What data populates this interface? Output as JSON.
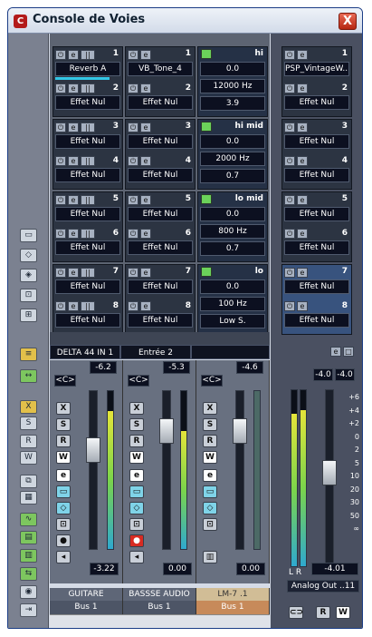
{
  "window": {
    "title": "Console de Voies",
    "close_label": "X"
  },
  "inserts": [
    [
      "Reverb A",
      "Effet Nul",
      "Effet Nul",
      "Effet Nul",
      "Effet Nul",
      "Effet Nul",
      "Effet Nul",
      "Effet Nul"
    ],
    [
      "VB_Tone_4",
      "Effet Nul",
      "Effet Nul",
      "Effet Nul",
      "Effet Nul",
      "Effet Nul",
      "Effet Nul",
      "Effet Nul"
    ]
  ],
  "slot_numbers": [
    "1",
    "2",
    "3",
    "4",
    "5",
    "6",
    "7",
    "8"
  ],
  "eq": [
    {
      "name": "hi",
      "gain": "0.0",
      "freq": "12000 Hz",
      "q": "3.9"
    },
    {
      "name": "hi mid",
      "gain": "0.0",
      "freq": "2000 Hz",
      "q": "0.7"
    },
    {
      "name": "lo mid",
      "gain": "0.0",
      "freq": "800 Hz",
      "q": "0.7"
    },
    {
      "name": "lo",
      "gain": "0.0",
      "freq": "100 Hz",
      "q": "Low S."
    }
  ],
  "master_inserts": [
    "PSP_VintageW...er",
    "Effet Nul",
    "Effet Nul",
    "Effet Nul",
    "Effet Nul",
    "Effet Nul",
    "Effet Nul",
    "Effet Nul"
  ],
  "routing": {
    "input": "DELTA 44 IN 1",
    "output": "Entrée 2"
  },
  "channels": [
    {
      "name": "GUITARE",
      "bus": "Bus 1",
      "pan": "<C>",
      "level": "-6.2",
      "fader": "-3.22"
    },
    {
      "name": "BASSSE AUDIO",
      "bus": "Bus 1",
      "pan": "<C>",
      "level": "-5.3",
      "fader": "0.00"
    },
    {
      "name": "LM-7 .1",
      "bus": "Bus 1",
      "pan": "<C>",
      "level": "-4.6",
      "fader": "0.00"
    }
  ],
  "master": {
    "level_l": "-4.0",
    "level_r": "-4.0",
    "fader": "-4.01",
    "name": "Analog Out ..11",
    "lr": [
      "L",
      "R"
    ],
    "scale": [
      "+6",
      "+4",
      "+2",
      "0",
      "2",
      "5",
      "10",
      "20",
      "30",
      "50",
      "∞"
    ]
  },
  "button_labels": {
    "x": "X",
    "s": "S",
    "r": "R",
    "w": "W",
    "e": "e"
  }
}
